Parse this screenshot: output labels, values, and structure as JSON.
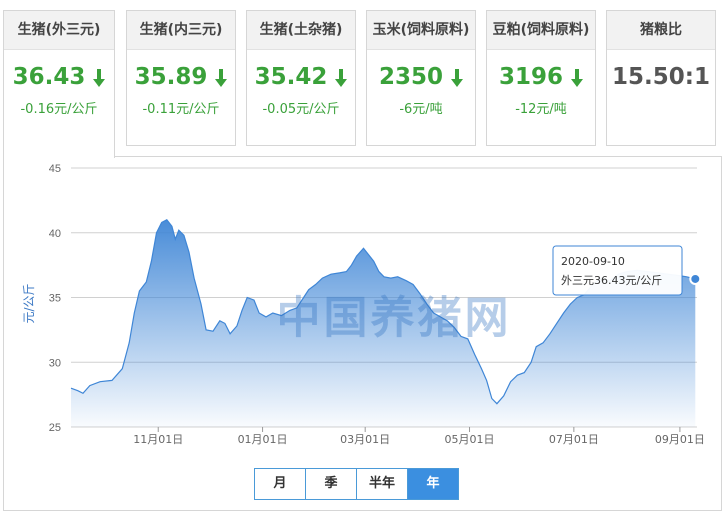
{
  "cards": [
    {
      "title": "生猪(外三元)",
      "value": "36.43",
      "change": "-0.16元/公斤",
      "trend": "down"
    },
    {
      "title": "生猪(内三元)",
      "value": "35.89",
      "change": "-0.11元/公斤",
      "trend": "down"
    },
    {
      "title": "生猪(土杂猪)",
      "value": "35.42",
      "change": "-0.05元/公斤",
      "trend": "down"
    },
    {
      "title": "玉米(饲料原料)",
      "value": "2350",
      "change": "-6元/吨",
      "trend": "down"
    },
    {
      "title": "豆粕(饲料原料)",
      "value": "3196",
      "change": "-12元/吨",
      "trend": "down"
    },
    {
      "title": "猪粮比",
      "value": "15.50:1",
      "change": "",
      "trend": "none"
    }
  ],
  "range_buttons": [
    "月",
    "季",
    "半年",
    "年"
  ],
  "active_range": "年",
  "colors": {
    "down": "#3aa13a",
    "line": "#3f86d6",
    "accent": "#3b8fe0"
  },
  "chart_data": {
    "type": "area",
    "title": "",
    "xlabel": "",
    "ylabel": "元/公斤",
    "ylim": [
      25,
      45
    ],
    "yticks": [
      25,
      30,
      35,
      40,
      45
    ],
    "xlim": [
      "2019-09-11",
      "2020-09-11"
    ],
    "xticks": [
      {
        "date": "2019-11-01",
        "label": "11月01日"
      },
      {
        "date": "2020-01-01",
        "label": "01月01日"
      },
      {
        "date": "2020-03-01",
        "label": "03月01日"
      },
      {
        "date": "2020-05-01",
        "label": "05月01日"
      },
      {
        "date": "2020-07-01",
        "label": "07月01日"
      },
      {
        "date": "2020-09-01",
        "label": "09月01日"
      }
    ],
    "grid": true,
    "watermark": "中国养猪网",
    "tooltip": {
      "date": "2020-09-10",
      "label": "外三元36.43元/公斤"
    },
    "series": [
      {
        "name": "外三元",
        "points": [
          [
            "2019-09-11",
            28.0
          ],
          [
            "2019-09-15",
            27.8
          ],
          [
            "2019-09-18",
            27.6
          ],
          [
            "2019-09-22",
            28.2
          ],
          [
            "2019-09-28",
            28.5
          ],
          [
            "2019-10-05",
            28.6
          ],
          [
            "2019-10-11",
            29.5
          ],
          [
            "2019-10-15",
            31.5
          ],
          [
            "2019-10-18",
            33.8
          ],
          [
            "2019-10-21",
            35.5
          ],
          [
            "2019-10-25",
            36.2
          ],
          [
            "2019-10-28",
            37.8
          ],
          [
            "2019-10-31",
            40.0
          ],
          [
            "2019-11-03",
            40.8
          ],
          [
            "2019-11-06",
            41.0
          ],
          [
            "2019-11-09",
            40.5
          ],
          [
            "2019-11-11",
            39.5
          ],
          [
            "2019-11-13",
            40.2
          ],
          [
            "2019-11-16",
            39.8
          ],
          [
            "2019-11-19",
            38.5
          ],
          [
            "2019-11-22",
            36.5
          ],
          [
            "2019-11-26",
            34.5
          ],
          [
            "2019-11-29",
            32.5
          ],
          [
            "2019-12-03",
            32.4
          ],
          [
            "2019-12-07",
            33.2
          ],
          [
            "2019-12-10",
            33.0
          ],
          [
            "2019-12-13",
            32.2
          ],
          [
            "2019-12-17",
            32.8
          ],
          [
            "2019-12-20",
            34.0
          ],
          [
            "2019-12-23",
            35.0
          ],
          [
            "2019-12-27",
            34.8
          ],
          [
            "2019-12-30",
            33.8
          ],
          [
            "2020-01-03",
            33.5
          ],
          [
            "2020-01-07",
            33.8
          ],
          [
            "2020-01-12",
            33.6
          ],
          [
            "2020-01-17",
            34.0
          ],
          [
            "2020-01-21",
            34.2
          ],
          [
            "2020-01-25",
            35.0
          ],
          [
            "2020-01-28",
            35.6
          ],
          [
            "2020-02-01",
            36.0
          ],
          [
            "2020-02-05",
            36.5
          ],
          [
            "2020-02-10",
            36.8
          ],
          [
            "2020-02-15",
            36.9
          ],
          [
            "2020-02-19",
            37.0
          ],
          [
            "2020-02-22",
            37.5
          ],
          [
            "2020-02-25",
            38.2
          ],
          [
            "2020-02-29",
            38.8
          ],
          [
            "2020-03-03",
            38.3
          ],
          [
            "2020-03-06",
            37.8
          ],
          [
            "2020-03-09",
            37.0
          ],
          [
            "2020-03-12",
            36.6
          ],
          [
            "2020-03-16",
            36.5
          ],
          [
            "2020-03-20",
            36.6
          ],
          [
            "2020-03-25",
            36.3
          ],
          [
            "2020-03-29",
            36.0
          ],
          [
            "2020-04-02",
            35.3
          ],
          [
            "2020-04-06",
            34.5
          ],
          [
            "2020-04-10",
            33.8
          ],
          [
            "2020-04-14",
            33.5
          ],
          [
            "2020-04-18",
            33.2
          ],
          [
            "2020-04-22",
            32.7
          ],
          [
            "2020-04-26",
            32.0
          ],
          [
            "2020-04-30",
            31.8
          ],
          [
            "2020-05-04",
            30.6
          ],
          [
            "2020-05-08",
            29.5
          ],
          [
            "2020-05-11",
            28.6
          ],
          [
            "2020-05-14",
            27.2
          ],
          [
            "2020-05-17",
            26.8
          ],
          [
            "2020-05-21",
            27.4
          ],
          [
            "2020-05-25",
            28.5
          ],
          [
            "2020-05-29",
            29.0
          ],
          [
            "2020-06-02",
            29.2
          ],
          [
            "2020-06-06",
            30.0
          ],
          [
            "2020-06-09",
            31.2
          ],
          [
            "2020-06-13",
            31.5
          ],
          [
            "2020-06-17",
            32.2
          ],
          [
            "2020-06-21",
            33.0
          ],
          [
            "2020-06-25",
            33.8
          ],
          [
            "2020-06-29",
            34.5
          ],
          [
            "2020-07-03",
            35.0
          ],
          [
            "2020-07-07",
            35.2
          ],
          [
            "2020-07-12",
            36.0
          ],
          [
            "2020-07-17",
            36.5
          ],
          [
            "2020-07-22",
            36.3
          ],
          [
            "2020-07-27",
            36.8
          ],
          [
            "2020-08-01",
            37.0
          ],
          [
            "2020-08-07",
            37.1
          ],
          [
            "2020-08-13",
            37.0
          ],
          [
            "2020-08-19",
            36.9
          ],
          [
            "2020-08-25",
            36.8
          ],
          [
            "2020-08-31",
            36.7
          ],
          [
            "2020-09-05",
            36.6
          ],
          [
            "2020-09-10",
            36.43
          ]
        ]
      }
    ]
  }
}
